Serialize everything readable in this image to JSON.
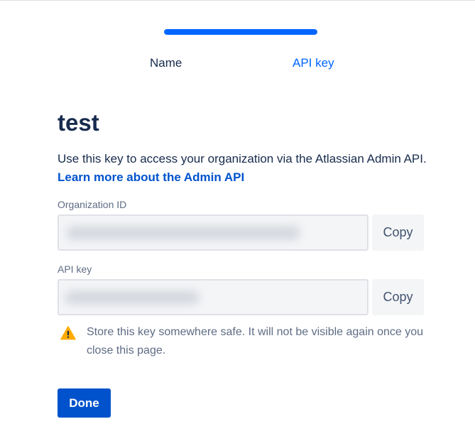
{
  "progress": {
    "fraction": 1.0,
    "color": "#0065ff"
  },
  "steps": [
    {
      "label": "Name",
      "state": "complete"
    },
    {
      "label": "API key",
      "state": "current"
    }
  ],
  "title": "test",
  "description": {
    "text": "Use this key to access your organization via the Atlassian Admin API. ",
    "link": "Learn more about the Admin API"
  },
  "fields": {
    "organization_id": {
      "label": "Organization ID",
      "copy_label": "Copy"
    },
    "api_key": {
      "label": "API key",
      "copy_label": "Copy"
    }
  },
  "warning": {
    "icon": "warning-icon",
    "text": "Store this key somewhere safe. It will not be visible again once you close this page."
  },
  "done_label": "Done",
  "colors": {
    "primary": "#0052cc",
    "link": "#0052cc",
    "warning": "#ffab00",
    "text": "#172b4d"
  }
}
